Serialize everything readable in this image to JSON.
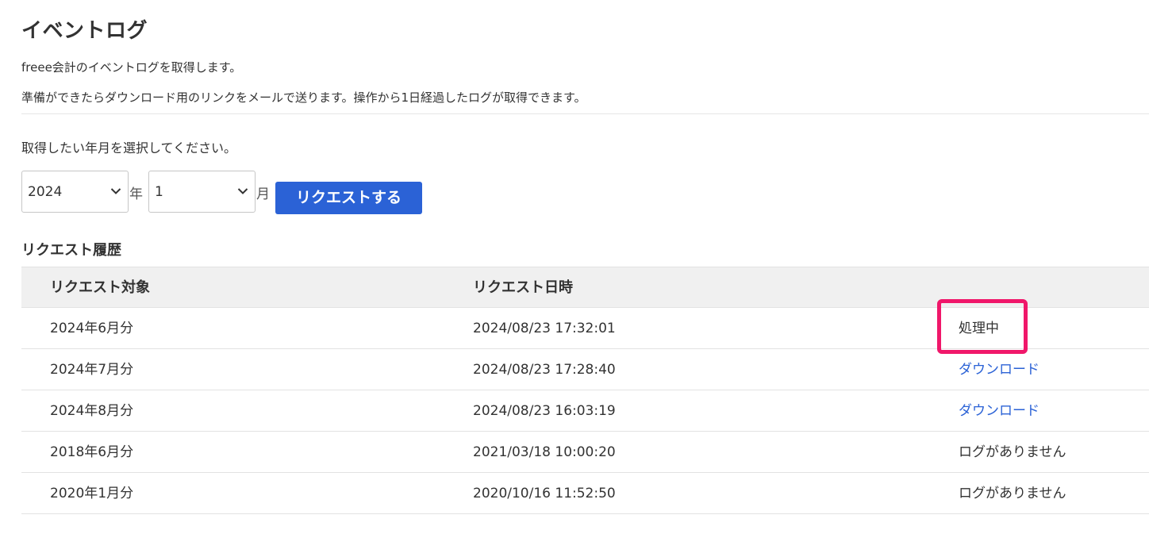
{
  "page": {
    "title": "イベントログ",
    "description_line1": "freee会計のイベントログを取得します。",
    "description_line2": "準備ができたらダウンロード用のリンクをメールで送ります。操作から1日経過したログが取得できます。"
  },
  "request_form": {
    "prompt": "取得したい年月を選択してください。",
    "year_value": "2024",
    "year_unit": "年",
    "month_value": "1",
    "month_unit": "月",
    "submit_label": "リクエストする",
    "submit_color": "#2b62d6"
  },
  "history": {
    "heading": "リクエスト履歴",
    "columns": [
      "リクエスト対象",
      "リクエスト日時",
      ""
    ],
    "rows": [
      {
        "target": "2024年6月分",
        "requested_at": "2024/08/23 17:32:01",
        "status": "処理中",
        "status_type": "text"
      },
      {
        "target": "2024年7月分",
        "requested_at": "2024/08/23 17:28:40",
        "status": "ダウンロード",
        "status_type": "link"
      },
      {
        "target": "2024年8月分",
        "requested_at": "2024/08/23 16:03:19",
        "status": "ダウンロード",
        "status_type": "link"
      },
      {
        "target": "2018年6月分",
        "requested_at": "2021/03/18 10:00:20",
        "status": "ログがありません",
        "status_type": "text"
      },
      {
        "target": "2020年1月分",
        "requested_at": "2020/10/16 11:52:50",
        "status": "ログがありません",
        "status_type": "text"
      }
    ]
  },
  "annotation": {
    "highlight_color": "#f0176a",
    "highlighted_status": "処理中"
  }
}
